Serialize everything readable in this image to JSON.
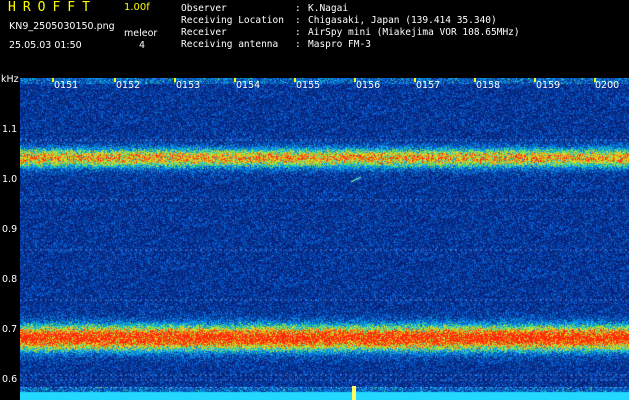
{
  "header": {
    "app_title": "HROFFT",
    "version": "1.00f",
    "filename": "KN9_2505030150.png",
    "mode_label": "meleor",
    "datetime": "25.05.03 01:50",
    "mode_value": "4"
  },
  "station_info": [
    {
      "key": "Observer",
      "value": "K.Nagai"
    },
    {
      "key": "Receiving Location",
      "value": "Chigasaki, Japan (139.414 35.340)"
    },
    {
      "key": "Receiver",
      "value": "AirSpy mini (Miakejima VOR 108.65MHz)"
    },
    {
      "key": "Receiving antenna",
      "value": "Maspro FM-3"
    }
  ],
  "axis": {
    "unit": "kHz",
    "time_labels": [
      "0151",
      "0152",
      "0153",
      "0154",
      "0155",
      "0156",
      "0157",
      "0158",
      "0159",
      "0200"
    ],
    "freq_labels": [
      "1.1",
      "1.0",
      "0.9",
      "0.8",
      "0.7",
      "0.6"
    ]
  },
  "colors": {
    "background": "#000000",
    "title": "#ffff00",
    "text": "#ffffff",
    "noise_floor": "#0a1f8f",
    "signal_hot": "#ff2a00",
    "signal_mid": "#20c0ff",
    "tick_marker": "#ffff00"
  },
  "spectrum_bands": [
    {
      "freq_khz": 1.045,
      "strength": 0.75
    },
    {
      "freq_khz": 0.685,
      "strength": 1.0
    }
  ],
  "icons": {
    "meteor_trace": "meteor-trace-icon"
  }
}
